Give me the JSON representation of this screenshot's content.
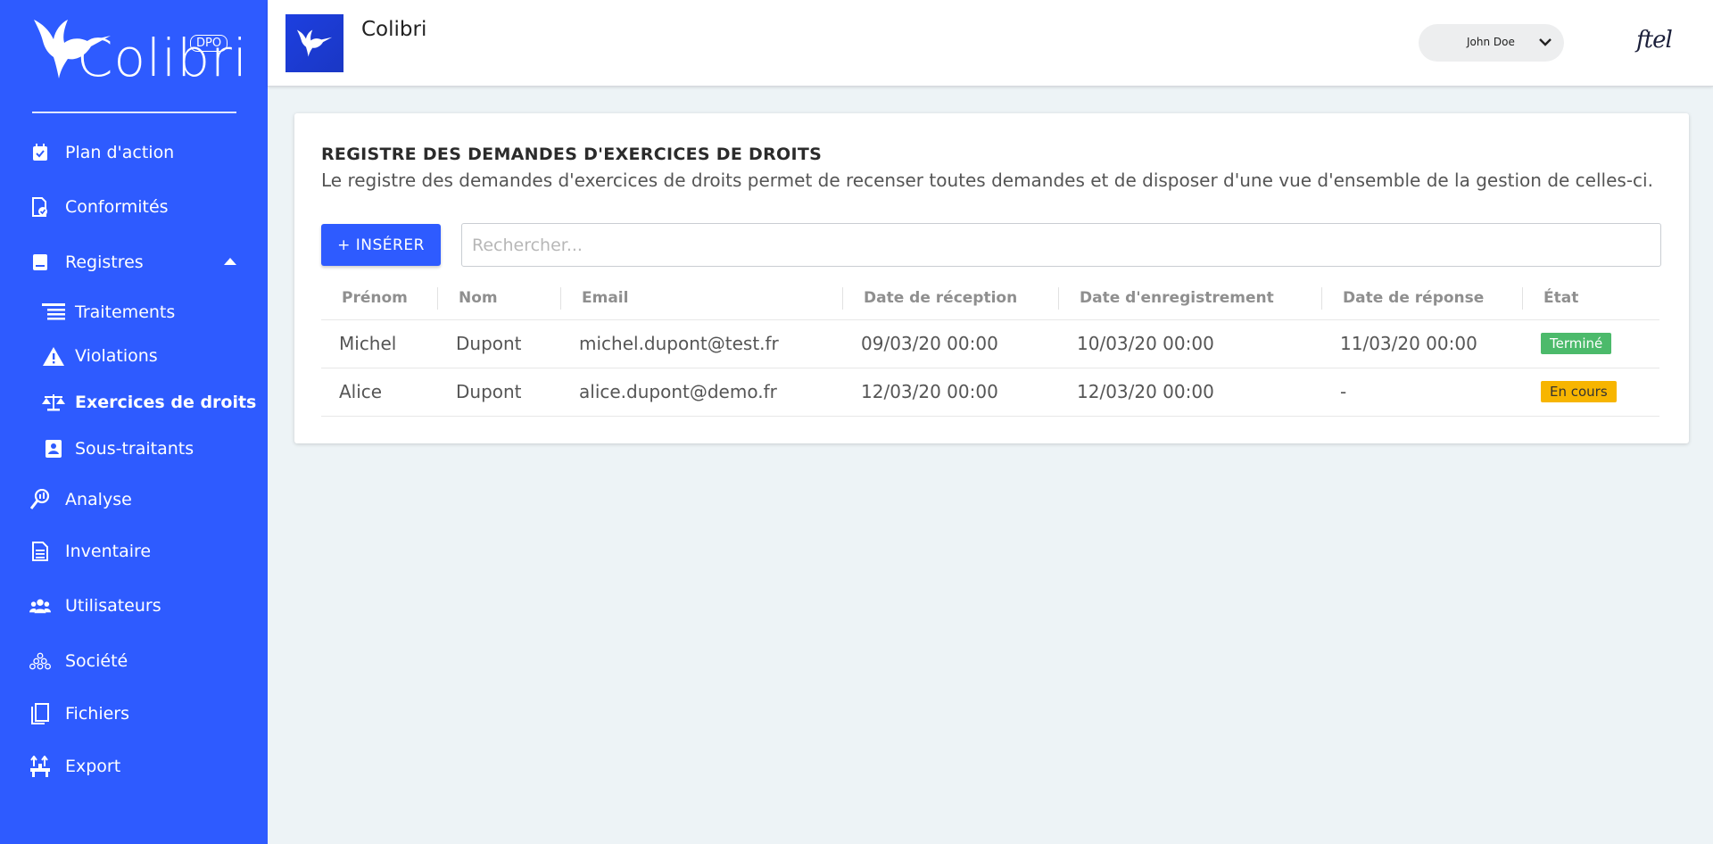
{
  "brand": {
    "name": "Colibri",
    "badge": "DPO"
  },
  "sidebar": {
    "items": [
      {
        "label": "Plan d'action",
        "icon": "calendar-check-icon"
      },
      {
        "label": "Conformités",
        "icon": "document-check-icon"
      },
      {
        "label": "Registres",
        "icon": "book-icon",
        "expanded": true
      },
      {
        "label": "Traitements",
        "icon": "list-icon",
        "sub": true
      },
      {
        "label": "Violations",
        "icon": "warning-icon",
        "sub": true
      },
      {
        "label": "Exercices de droits",
        "icon": "scale-icon",
        "sub": true,
        "active": true
      },
      {
        "label": "Sous-traitants",
        "icon": "contact-card-icon",
        "sub": true
      },
      {
        "label": "Analyse",
        "icon": "analysis-icon"
      },
      {
        "label": "Inventaire",
        "icon": "inventory-icon"
      },
      {
        "label": "Utilisateurs",
        "icon": "users-icon"
      },
      {
        "label": "Société",
        "icon": "company-icon"
      },
      {
        "label": "Fichiers",
        "icon": "files-icon"
      },
      {
        "label": "Export",
        "icon": "export-icon"
      }
    ]
  },
  "topbar": {
    "title": "Colibri",
    "user": "John Doe",
    "partner_logo": "ftel"
  },
  "card": {
    "title": "REGISTRE DES DEMANDES D'EXERCICES DE DROITS",
    "description": "Le registre des demandes d'exercices de droits permet de recenser toutes demandes et de disposer d'une vue d'ensemble de la gestion de celles-ci.",
    "insert_label": "+ INSÉRER",
    "search_placeholder": "Rechercher..."
  },
  "table": {
    "columns": [
      "Prénom",
      "Nom",
      "Email",
      "Date de réception",
      "Date d'enregistrement",
      "Date de réponse",
      "État"
    ],
    "rows": [
      {
        "prenom": "Michel",
        "nom": "Dupont",
        "email": "michel.dupont@test.fr",
        "reception": "09/03/20 00:00",
        "enregistrement": "10/03/20 00:00",
        "reponse": "11/03/20 00:00",
        "etat": "Terminé"
      },
      {
        "prenom": "Alice",
        "nom": "Dupont",
        "email": "alice.dupont@demo.fr",
        "reception": "12/03/20 00:00",
        "enregistrement": "12/03/20 00:00",
        "reponse": "-",
        "etat": "En cours"
      }
    ]
  },
  "colors": {
    "primary": "#2e5bff",
    "success": "#4cba6b",
    "warning": "#f7b500"
  }
}
